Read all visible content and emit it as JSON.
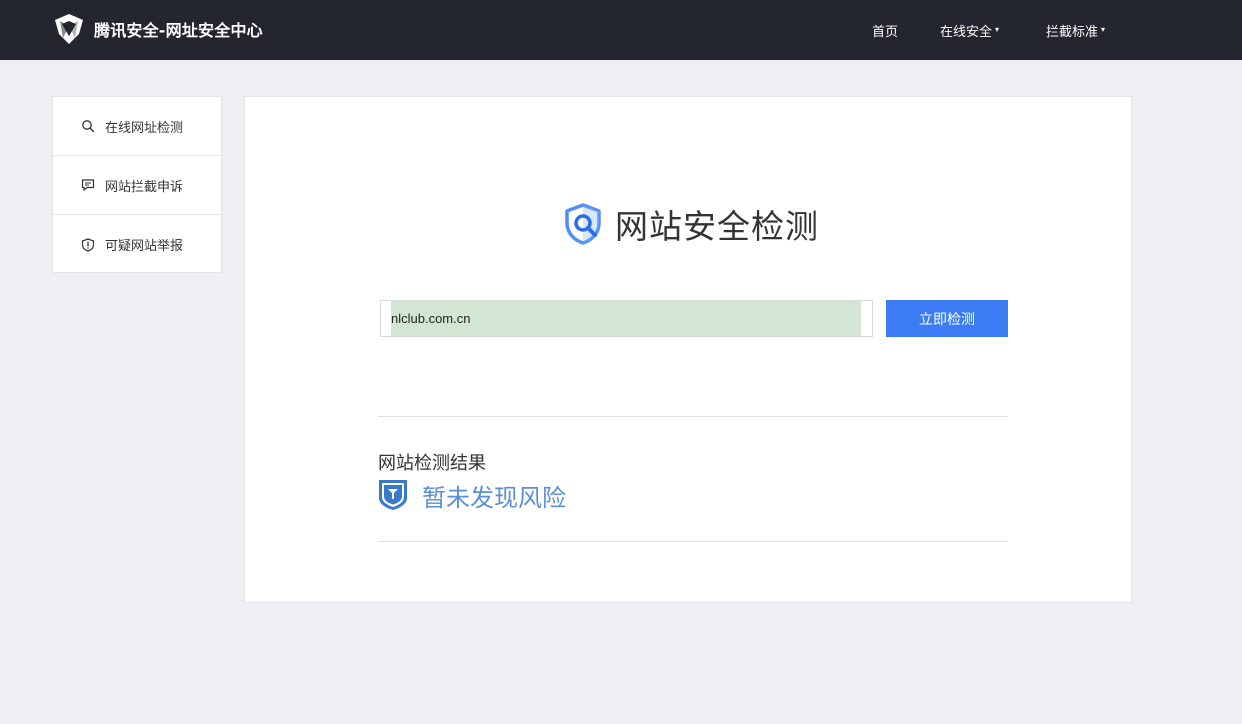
{
  "header": {
    "logo_icon": "tencent-security-logo-icon",
    "title": "腾讯安全-网址安全中心",
    "nav": {
      "home": "首页",
      "online_security": "在线安全",
      "block_standard": "拦截标准",
      "dropdown_caret": "▾"
    }
  },
  "sidebar": {
    "items": [
      {
        "label": "在线网址检测",
        "icon": "search-icon"
      },
      {
        "label": "网站拦截申诉",
        "icon": "message-icon"
      },
      {
        "label": "可疑网站举报",
        "icon": "shield-alert-icon"
      }
    ]
  },
  "main": {
    "heading_icon": "shield-search-icon",
    "title": "网站安全检测",
    "url_input_value": "nlclub.com.cn",
    "check_button_label": "立即检测",
    "result_label": "网站检测结果",
    "result_icon": "shield-safe-icon",
    "result_text": "暂未发现风险"
  },
  "colors": {
    "topbar": "#23252f",
    "page_background": "#efeff3",
    "accent_button": "#3b7cf5",
    "input_highlight": "#d2e6d3",
    "result_text": "#5a8fd8"
  }
}
